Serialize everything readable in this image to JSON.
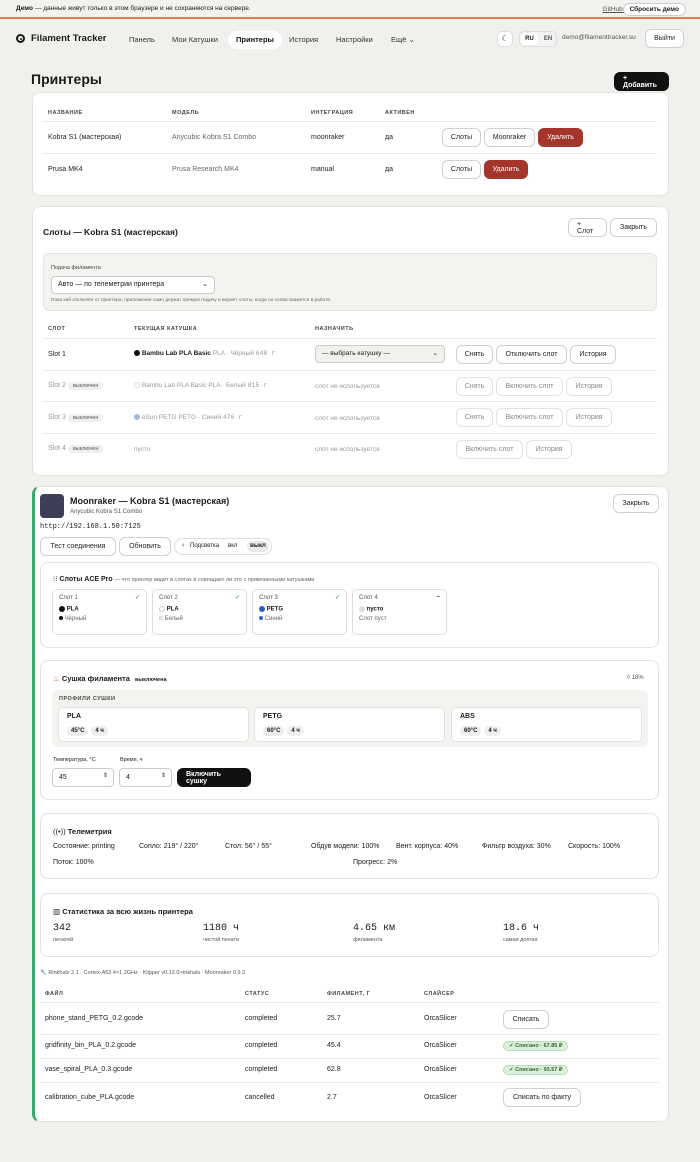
{
  "banner": {
    "bold": "Демо",
    "text": "— данные живут только в этом браузере и не сохраняются на сервере.",
    "github": "GitHub ↗",
    "reset": "Сбросить демо"
  },
  "nav": {
    "brand": "Filament Tracker",
    "items": [
      "Панель",
      "Мои Катушки",
      "Принтеры",
      "История",
      "Настройки",
      "Ещё"
    ],
    "active": "Принтеры",
    "lang": [
      "RU",
      "EN"
    ],
    "email": "demo@filamenttracker.su",
    "logout": "Выйти"
  },
  "page": {
    "title": "Принтеры",
    "add": "+ Добавить"
  },
  "printers": {
    "headers": [
      "НАЗВАНИЕ",
      "МОДЕЛЬ",
      "ИНТЕГРАЦИЯ",
      "АКТИВЕН"
    ],
    "rows": [
      {
        "name": "Kobra S1 (мастерская)",
        "model": "Anycubic Kobra S1 Combo",
        "integration": "moonraker",
        "active": "да",
        "btns": [
          "Слоты",
          "Moonraker",
          "Удалить"
        ]
      },
      {
        "name": "Prusa MK4",
        "model": "Prusa Research MK4",
        "integration": "manual",
        "active": "да",
        "btns": [
          "Слоты",
          "Удалить"
        ]
      }
    ]
  },
  "slots": {
    "title": "Слоты — Kobra S1 (мастерская)",
    "add": "+ Слот",
    "close": "Закрыть",
    "feed_label": "Подача филамента",
    "feed_value": "Авто — по телеметрии принтера",
    "feed_hint": "Пока хаб отключён от принтера, приложение само держит прямую подачу и вернёт слоты, когда он снова окажется в работе.",
    "headers": [
      "СЛОТ",
      "ТЕКУЩАЯ КАТУШКА",
      "НАЗНАЧИТЬ"
    ],
    "off": "выключен",
    "rows": [
      {
        "slot": "Slot 1",
        "spool": "Bambu Lab PLA Basic",
        "meta": "PLA · Чёрный",
        "weight": "648 г",
        "assign": "— выбрать катушку —",
        "b1": "Снять",
        "b2": "Отключить слот",
        "b3": "История"
      },
      {
        "slot": "Slot 2",
        "spool": "Bambu Lab PLA Basic",
        "meta": "PLA · Белый",
        "weight": "815 г",
        "assign": "слот не используется",
        "b1": "Снять",
        "b2": "Включить слот",
        "b3": "История"
      },
      {
        "slot": "Slot 3",
        "spool": "eSun PETG",
        "meta": "PETG · Синий",
        "weight": "476 г",
        "assign": "слот не используется",
        "b1": "Снять",
        "b2": "Включить слот",
        "b3": "История"
      },
      {
        "slot": "Slot 4",
        "spool": "пусто",
        "assign": "слот не используется",
        "b2": "Включить слот",
        "b3": "История"
      }
    ]
  },
  "moon": {
    "title": "Moonraker — Kobra S1 (мастерская)",
    "model": "Anycubic Kobra S1 Combo",
    "close": "Закрыть",
    "url": "http://192.168.1.50:7125",
    "test": "Тест соединения",
    "refresh": "Обновить",
    "light": "Подсветка",
    "on": "вкл",
    "off": "выкл",
    "ace_title": "Слоты ACE Pro",
    "ace_sub": "— что принтер видит в слотах и совпадает ли это с привязанными катушками",
    "ace": [
      {
        "slot": "Слот 1",
        "mat": "PLA",
        "color": "Чёрный",
        "mark": "✓"
      },
      {
        "slot": "Слот 2",
        "mat": "PLA",
        "color": "Белый",
        "mark": "✓"
      },
      {
        "slot": "Слот 3",
        "mat": "PETG",
        "color": "Синий",
        "mark": "✓"
      },
      {
        "slot": "Слот 4",
        "mat": "пусто",
        "color": "Слот пуст",
        "mark": "–"
      }
    ],
    "dry_title": "Сушка филамента",
    "dry_state": "выключена",
    "humidity": "18%",
    "profiles_label": "ПРОФИЛИ СУШКИ",
    "profiles": [
      {
        "name": "PLA",
        "t": "45°C",
        "h": "4 ч"
      },
      {
        "name": "PETG",
        "t": "60°C",
        "h": "4 ч"
      },
      {
        "name": "ABS",
        "t": "60°C",
        "h": "4 ч"
      }
    ],
    "temp_label": "Температура, °C",
    "time_label": "Время, ч",
    "temp": "45",
    "time": "4",
    "dry_btn": "Включить сушку",
    "tel_title": "Телеметрия",
    "tel": [
      [
        "Состояние:",
        "printing"
      ],
      [
        "Сопло:",
        "219° / 220°"
      ],
      [
        "Стол:",
        "56° / 55°"
      ],
      [
        "Обдув модели:",
        "100%"
      ],
      [
        "Вент. корпуса:",
        "40%"
      ],
      [
        "Фильтр воздуха:",
        "30%"
      ],
      [
        "Скорость:",
        "100%"
      ],
      [
        "Поток:",
        "100%"
      ],
      [
        "Прогресс:",
        "2%"
      ]
    ],
    "stat_title": "Статистика за всю жизнь принтера",
    "stats": [
      {
        "v": "342",
        "l": "печатей"
      },
      {
        "v": "1180 ч",
        "l": "чистой печати"
      },
      {
        "v": "4.65 км",
        "l": "филамента"
      },
      {
        "v": "18.6 ч",
        "l": "самая долгая"
      }
    ],
    "sys": "Rinkhals 2.1 · Cortex-A53 4×1.2GHz · Klipper v0.12.0-rinkhals · Moonraker 0.9.3",
    "jheaders": [
      "ФАЙЛ",
      "СТАТУС",
      "ФИЛАМЕНТ, Г",
      "СЛАЙСЕР"
    ],
    "jobs": [
      {
        "file": "phone_stand_PETG_0.2.gcode",
        "status": "completed",
        "fil": "25.7",
        "slicer": "OrcaSlicer",
        "act": "Списать"
      },
      {
        "file": "gridfinity_bin_PLA_0.2.gcode",
        "status": "completed",
        "fil": "45.4",
        "slicer": "OrcaSlicer",
        "act": "✓ Списано · 67.85 ₽"
      },
      {
        "file": "vase_spiral_PLA_0.3.gcode",
        "status": "completed",
        "fil": "62.8",
        "slicer": "OrcaSlicer",
        "act": "✓ Списано · 93.57 ₽"
      },
      {
        "file": "calibration_cube_PLA.gcode",
        "status": "cancelled",
        "fil": "2.7",
        "slicer": "OrcaSlicer",
        "act": "Списать по факту"
      }
    ]
  }
}
